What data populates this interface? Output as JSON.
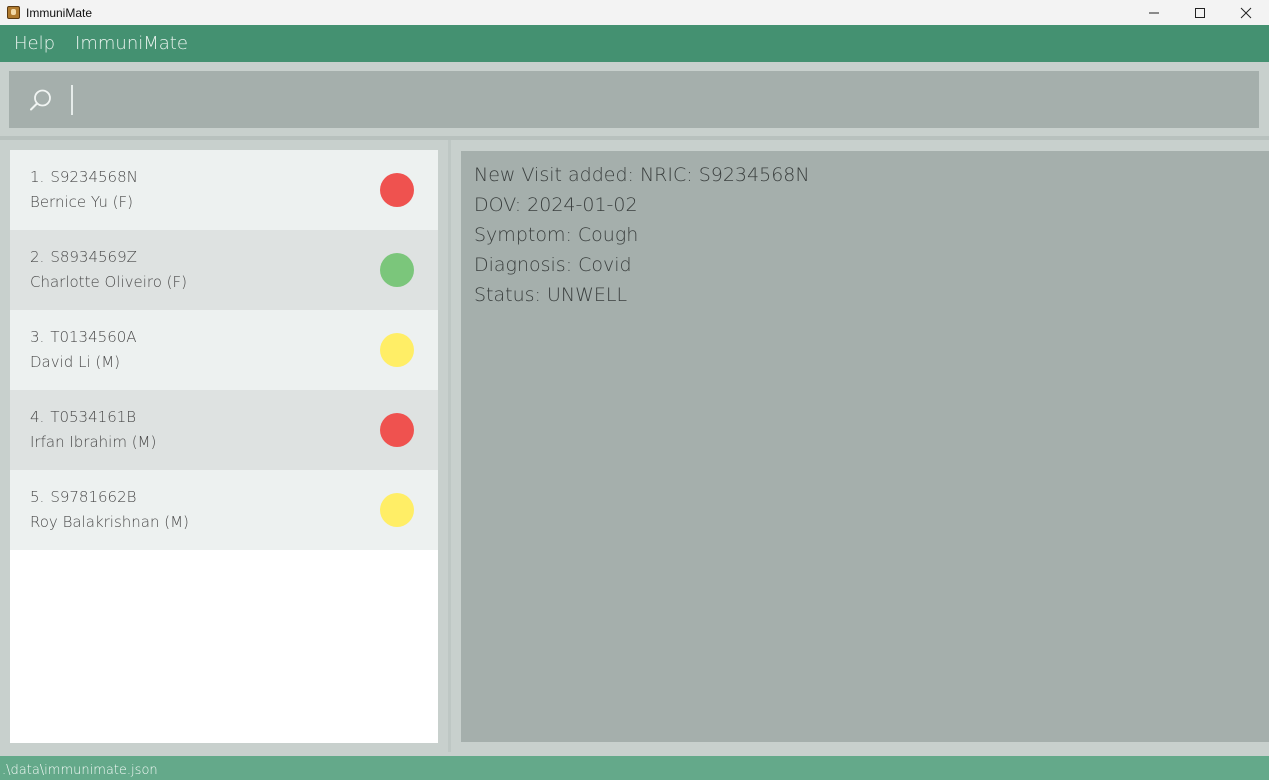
{
  "window": {
    "title": "ImmuniMate",
    "controls": {
      "minimize": "—",
      "maximize": "☐",
      "close": "✕"
    }
  },
  "menu": {
    "items": [
      {
        "label": "Help"
      },
      {
        "label": "ImmuniMate"
      }
    ]
  },
  "command": {
    "value": "",
    "icon": "search-icon"
  },
  "patients": [
    {
      "index": "1.",
      "nric": "S9234568N",
      "name": "Bernice Yu (F)",
      "status_color": "#ef524f"
    },
    {
      "index": "2.",
      "nric": "S8934569Z",
      "name": "Charlotte Oliveiro (F)",
      "status_color": "#7bc67b"
    },
    {
      "index": "3.",
      "nric": "T0134560A",
      "name": "David Li (M)",
      "status_color": "#ffee66"
    },
    {
      "index": "4.",
      "nric": "T0534161B",
      "name": "Irfan Ibrahim (M)",
      "status_color": "#ef524f"
    },
    {
      "index": "5.",
      "nric": "S9781662B",
      "name": "Roy Balakrishnan (M)",
      "status_color": "#ffee66"
    }
  ],
  "result": {
    "lines": [
      "New Visit added: NRIC: S9234568N",
      "DOV: 2024-01-02",
      "Symptom: Cough",
      "Diagnosis: Covid",
      "Status: UNWELL"
    ]
  },
  "status_bar": {
    "path": ".\\data\\immunimate.json"
  },
  "colors": {
    "menu_bg": "#449171",
    "status_bg": "#64a98a",
    "panel_bg": "#a5afac"
  }
}
